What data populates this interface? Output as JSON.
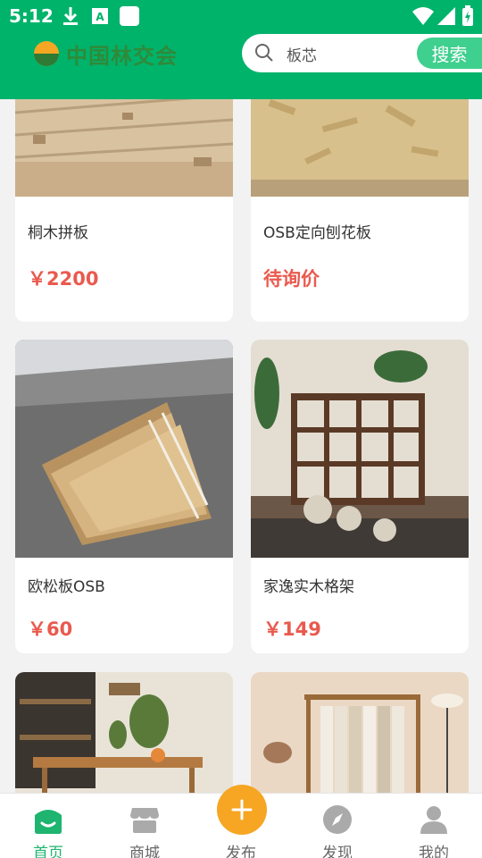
{
  "status_bar": {
    "time": "5:12"
  },
  "header": {
    "logo_text": "中国林交会",
    "search": {
      "value": "板芯",
      "button_label": "搜索"
    }
  },
  "products": [
    {
      "name": "桐木拼板",
      "price": "￥2200"
    },
    {
      "name": "OSB定向刨花板",
      "price": "待询价"
    },
    {
      "name": "欧松板OSB",
      "price": "￥60"
    },
    {
      "name": "家逸实木格架",
      "price": "￥149"
    },
    {
      "name": "",
      "price": ""
    },
    {
      "name": "",
      "price": ""
    }
  ],
  "tab_bar": {
    "items": [
      {
        "label": "首页",
        "icon": "home-icon",
        "active": true
      },
      {
        "label": "商城",
        "icon": "store-icon",
        "active": false
      },
      {
        "label": "发布",
        "icon": "plus-icon",
        "active": false
      },
      {
        "label": "发现",
        "icon": "compass-icon",
        "active": false
      },
      {
        "label": "我的",
        "icon": "person-icon",
        "active": false
      }
    ]
  },
  "colors": {
    "brand": "#00b36b",
    "price": "#e95a4e",
    "publish": "#f6a623"
  }
}
